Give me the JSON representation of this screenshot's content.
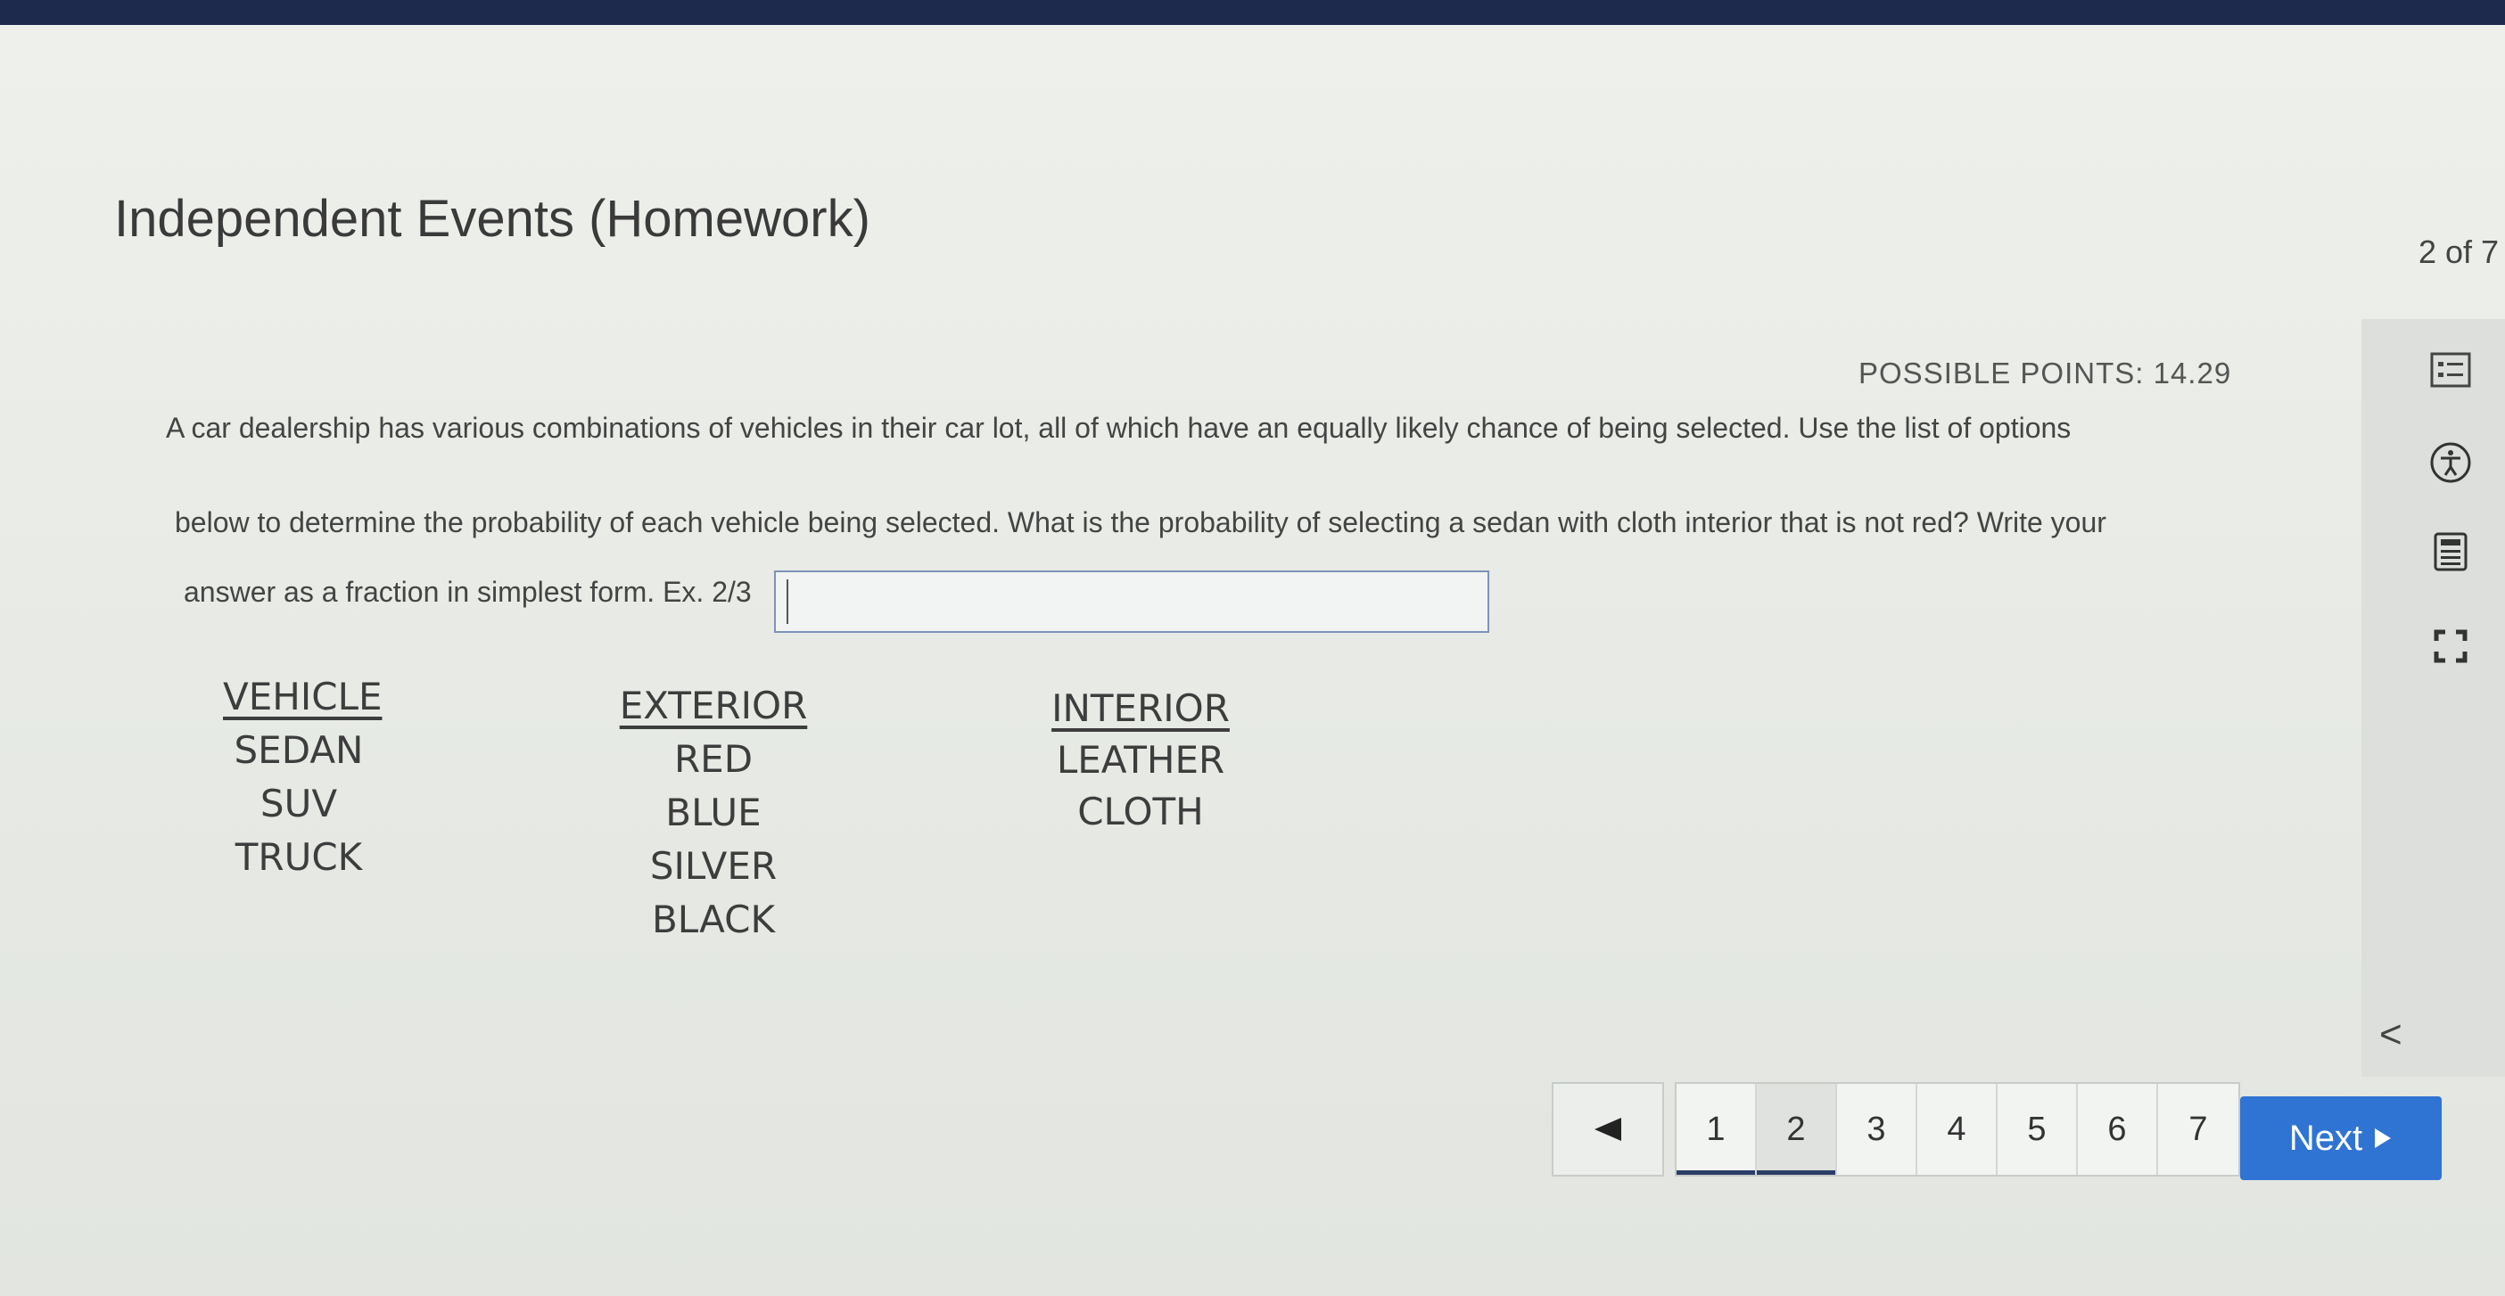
{
  "assignment": {
    "title": "Independent Events (Homework)",
    "counter": "2 of 7"
  },
  "question": {
    "points": "POSSIBLE POINTS: 14.29",
    "lines": [
      "A car dealership has various combinations of vehicles in their car lot, all of which have an equally likely chance of being selected.  Use the list of options",
      "below to determine the probability of each vehicle being selected.  What is the probability of selecting a sedan with cloth interior that is not red?  Write your",
      "answer as a fraction in simplest form. Ex. 2/3"
    ],
    "answer_value": ""
  },
  "options": {
    "vehicle": {
      "header": "VEHICLE",
      "items": [
        "SEDAN",
        "SUV",
        "TRUCK"
      ]
    },
    "exterior": {
      "header": "EXTERIOR",
      "items": [
        "RED",
        "BLUE",
        "SILVER",
        "BLACK"
      ]
    },
    "interior": {
      "header": "INTERIOR",
      "items": [
        "LEATHER",
        "CLOTH"
      ]
    }
  },
  "sidebar": {
    "icons": [
      "notes-icon",
      "accessibility-icon",
      "calculator-icon",
      "fullscreen-icon"
    ],
    "collapse_label": "<"
  },
  "pagination": {
    "pages": [
      "1",
      "2",
      "3",
      "4",
      "5",
      "6",
      "7"
    ],
    "current": "2",
    "next_label": "Next"
  },
  "colors": {
    "accent": "#2f74d3",
    "topbar": "#1d2a4e"
  }
}
